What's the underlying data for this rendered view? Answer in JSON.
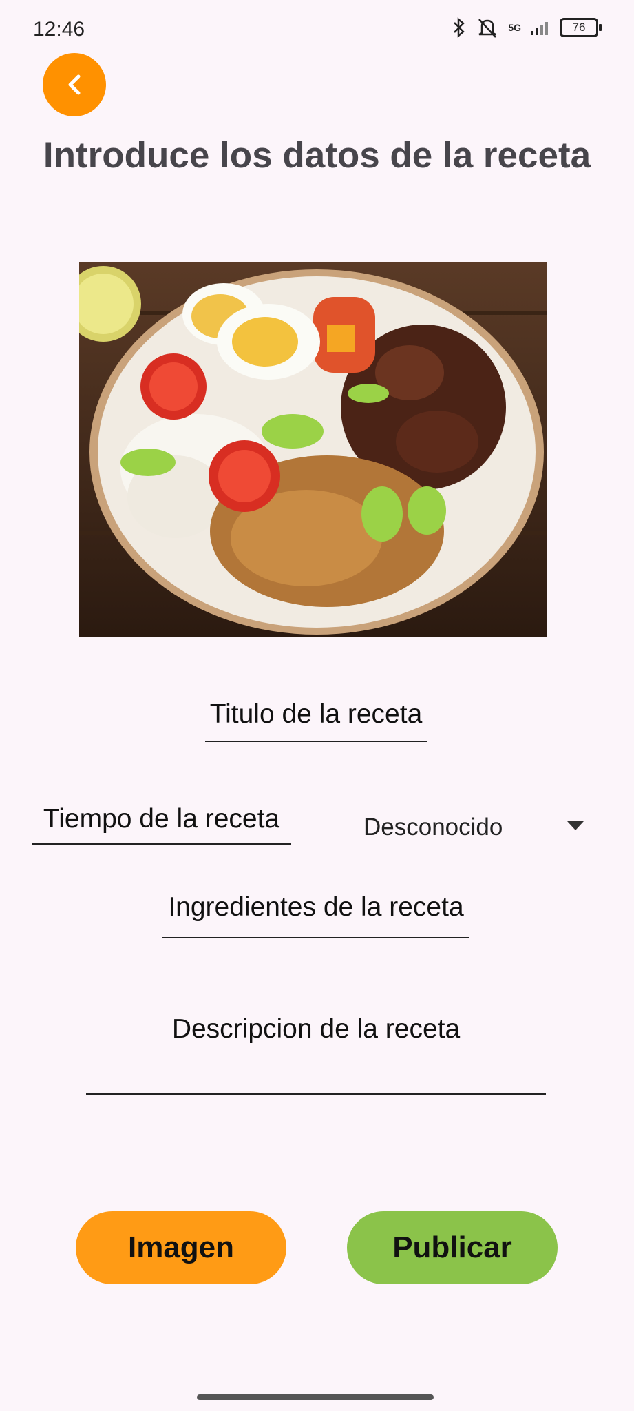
{
  "status_bar": {
    "time": "12:46",
    "network": "5G",
    "battery": "76"
  },
  "header": {
    "title": "Introduce los datos de la receta"
  },
  "image": {
    "icon": "food-plate-photo"
  },
  "form": {
    "titulo_placeholder": "Titulo de la receta",
    "tiempo_placeholder": "Tiempo de la receta",
    "tiempo_unit_selected": "Desconocido",
    "ingredientes_placeholder": "Ingredientes de la receta",
    "descripcion_placeholder": "Descripcion de la receta"
  },
  "actions": {
    "imagen_label": "Imagen",
    "publicar_label": "Publicar"
  },
  "colors": {
    "accent_orange": "#ff9100",
    "button_orange": "#ff9b15",
    "button_green": "#8bc34a",
    "background": "#fcf5fa"
  }
}
